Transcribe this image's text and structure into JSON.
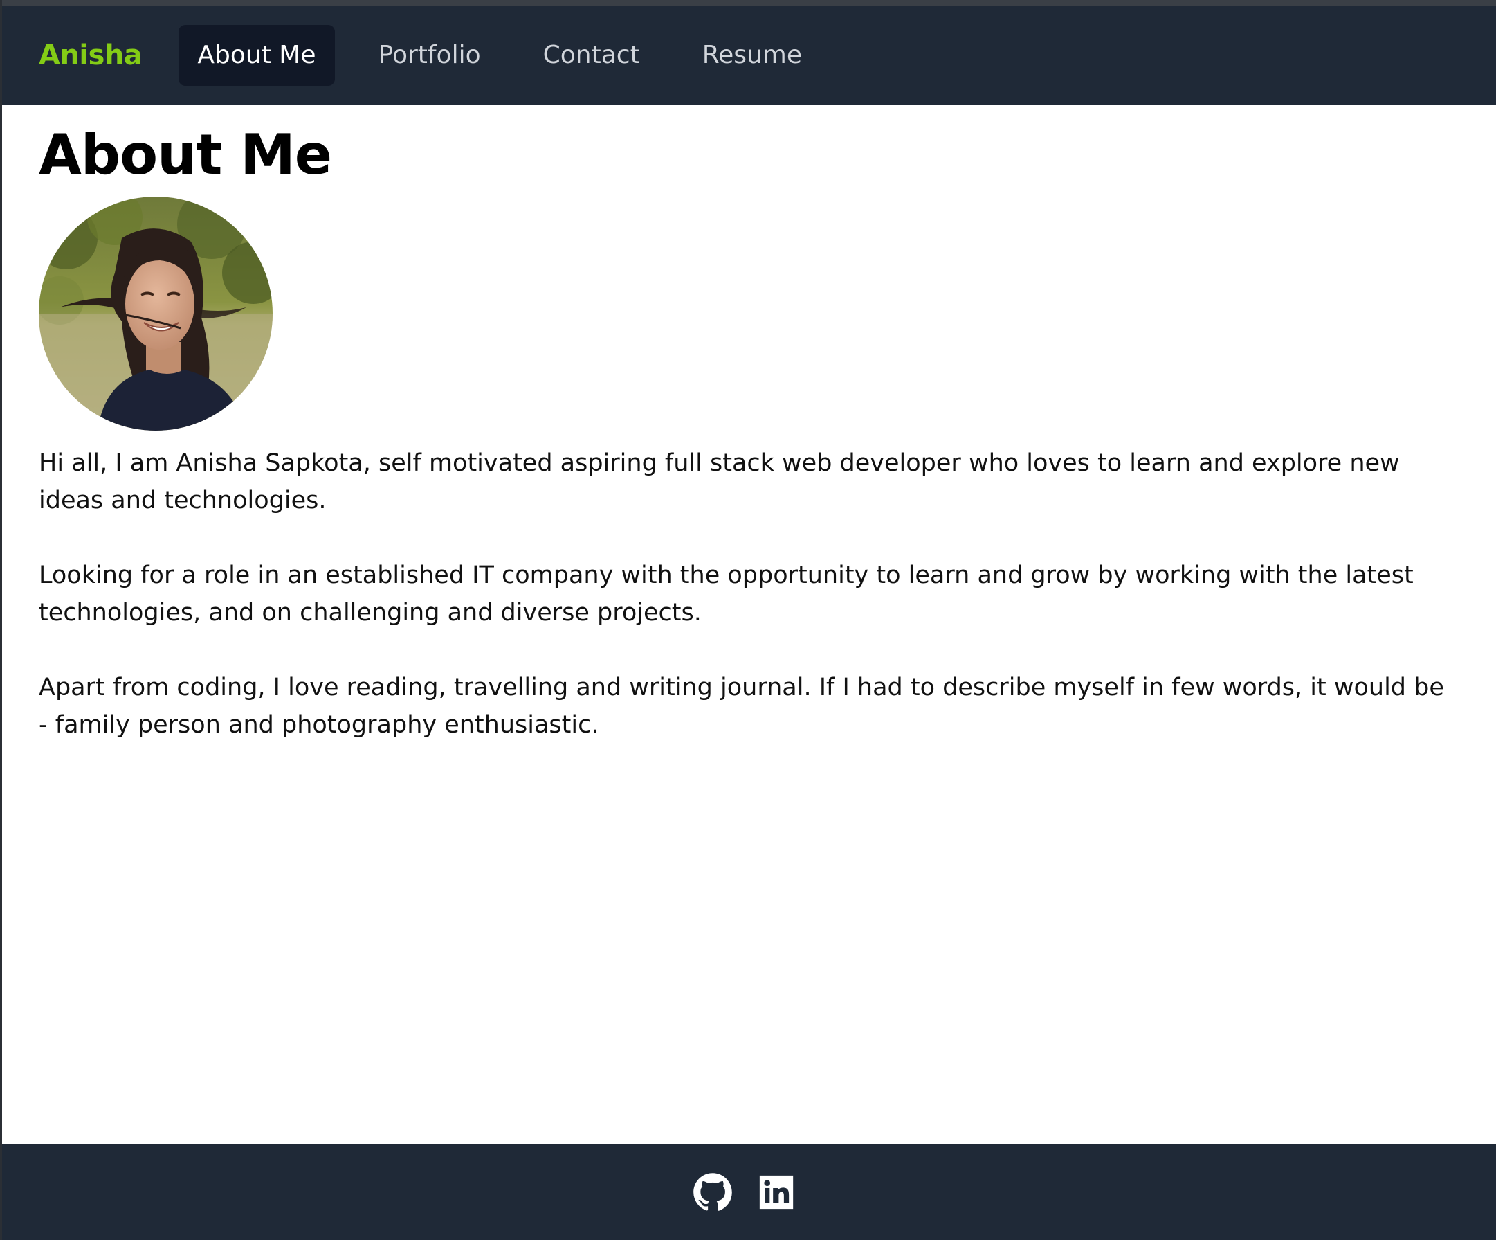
{
  "navbar": {
    "brand": "Anisha",
    "links": [
      {
        "label": "About Me",
        "active": true
      },
      {
        "label": "Portfolio",
        "active": false
      },
      {
        "label": "Contact",
        "active": false
      },
      {
        "label": "Resume",
        "active": false
      }
    ]
  },
  "main": {
    "title": "About Me",
    "avatar_icon": "profile-photo",
    "paragraphs": [
      "Hi all, I am Anisha Sapkota, self motivated aspiring full stack web developer who loves to learn and explore new ideas and technologies.",
      "Looking for a role in an established IT company with the opportunity to learn and grow by working with the latest technologies, and on challenging and diverse projects.",
      "Apart from coding, I love reading, travelling and writing journal. If I had to describe myself in few words, it would be - family person and photography enthusiastic."
    ]
  },
  "footer": {
    "icons": [
      "github-icon",
      "linkedin-icon"
    ]
  },
  "colors": {
    "nav_background": "#1f2937",
    "brand_accent": "#84cc16",
    "active_link_background": "#111827",
    "link_text": "#d1d5db"
  }
}
